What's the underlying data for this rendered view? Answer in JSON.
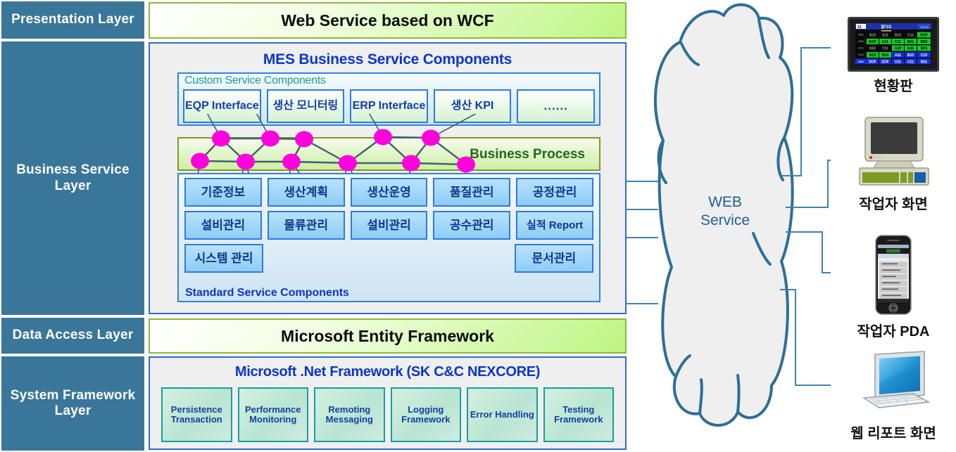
{
  "layers": [
    {
      "id": "presentation",
      "label": "Presentation Layer"
    },
    {
      "id": "business-service",
      "label": "Business Service Layer"
    },
    {
      "id": "data-access",
      "label": "Data Access Layer"
    },
    {
      "id": "system-framework",
      "label": "System Framework Layer"
    }
  ],
  "presentation": {
    "bar_label": "Web Service based on WCF"
  },
  "business": {
    "title": "MES Business Service Components",
    "custom": {
      "label": "Custom Service Components",
      "boxes": [
        "EQP Interface",
        "생산 모니터링",
        "ERP Interface",
        "생산 KPI",
        "......"
      ]
    },
    "business_process": {
      "label": "Business Process",
      "node_color": "#ff00dd",
      "link_color": "#3f5f6f"
    },
    "standard": {
      "label": "Standard Service Components",
      "rows": [
        [
          "기준정보",
          "생산계획",
          "생산운영",
          "품질관리",
          "공정관리"
        ],
        [
          "설비관리",
          "물류관리",
          "설비관리",
          "공수관리",
          "실적 Report"
        ],
        [
          "시스템 관리",
          "",
          "",
          "",
          "문서관리"
        ]
      ]
    }
  },
  "data_access": {
    "bar_label": "Microsoft Entity Framework"
  },
  "system": {
    "title": "Microsoft .Net Framework (SK C&C NEXCORE)",
    "boxes": [
      "Persistence Transaction",
      "Performance Monitoring",
      "Remoting Messaging",
      "Logging Framework",
      "Error Handling",
      "Testing Framework"
    ]
  },
  "cloud": {
    "line1": "WEB",
    "line2": "Service"
  },
  "devices": [
    {
      "id": "status-board",
      "label": "현황판",
      "icon": "status-board-icon"
    },
    {
      "id": "operator-screen",
      "label": "작업자 화면",
      "icon": "desktop-computer-icon"
    },
    {
      "id": "operator-pda",
      "label": "작업자 PDA",
      "icon": "smartphone-icon"
    },
    {
      "id": "web-report",
      "label": "웹 리포트 화면",
      "icon": "laptop-icon"
    }
  ],
  "status_board": {
    "header_left": "21",
    "header_center": "알다오",
    "header_right": "16:43",
    "rows": [
      {
        "id": "0001",
        "cells": [
          "B10",
          "A11",
          "B10",
          "C10",
          "DOF"
        ],
        "states": [
          "gray",
          "gray",
          "gray",
          "gray",
          "green"
        ]
      },
      {
        "id": "0006",
        "cells": [
          "EOF",
          "U11",
          "C21",
          "M11",
          "M23"
        ],
        "states": [
          "green",
          "green",
          "green",
          "green",
          "green"
        ]
      },
      {
        "id": "0011",
        "cells": [
          "N50",
          "T01",
          "OJP",
          "U40",
          "NP1"
        ],
        "states": [
          "gray",
          "gray",
          "green",
          "green",
          "green"
        ]
      },
      {
        "id": "0016",
        "cells": [
          "SOZ",
          "B10",
          "A11",
          "B10",
          "C10"
        ],
        "states": [
          "green",
          "green",
          "blue",
          "blue",
          "blue"
        ]
      },
      {
        "id": "0021",
        "cells": [
          "DOF",
          "EOF",
          "U11",
          "C21",
          "M11"
        ],
        "states": [
          "blue",
          "blue",
          "blue",
          "blue",
          "blue"
        ]
      }
    ]
  },
  "colors": {
    "layer_sidebar": "#3a7699",
    "green_bar": "#bdf583",
    "green_bar_border": "#8fb73a",
    "panel_border": "#2f6ad0",
    "title_blue": "#0b36c9",
    "teal_label": "#1a9d9d",
    "std_box": "#8ccdf5",
    "cloud_stroke": "#2e6e96",
    "cloud_fill": "#efefef",
    "connector": "#3e83ad"
  }
}
